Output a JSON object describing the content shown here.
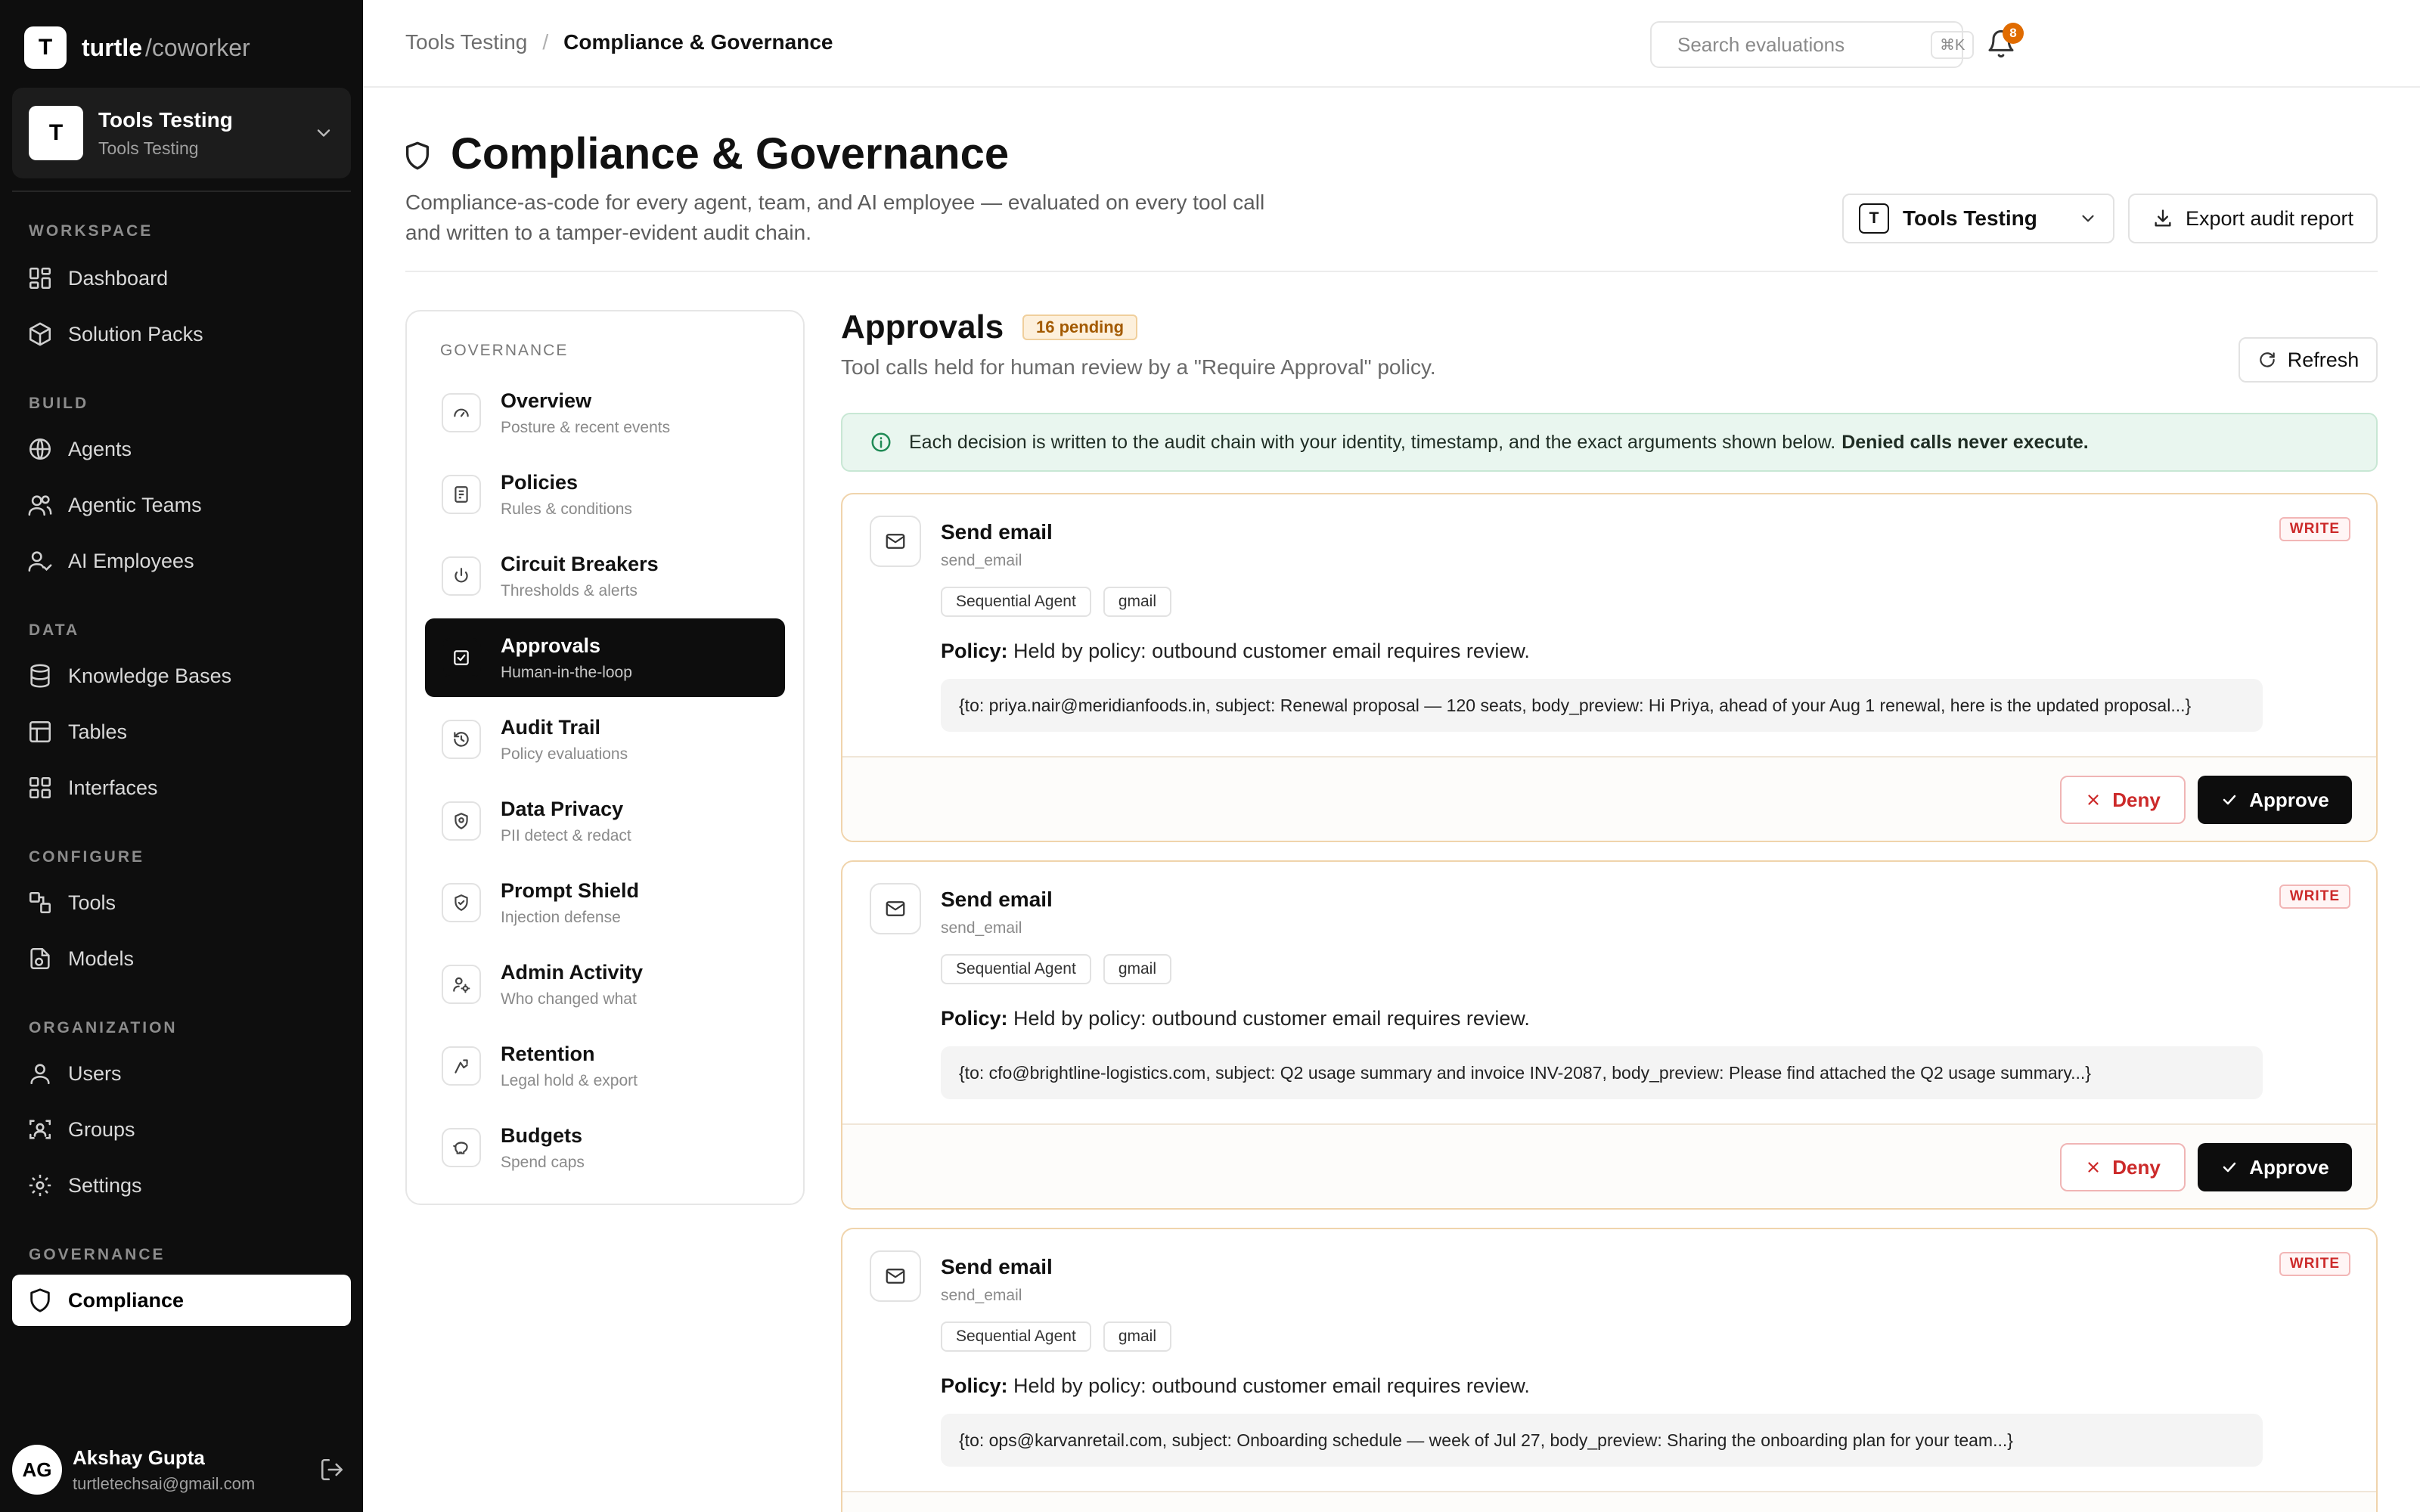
{
  "brand": {
    "logo_letter": "T",
    "name": "turtle",
    "suffix": "/coworker"
  },
  "workspace": {
    "avatar": "T",
    "title": "Tools Testing",
    "subtitle": "Tools Testing"
  },
  "sidebar": {
    "sections": [
      {
        "label": "WORKSPACE",
        "items": [
          {
            "label": "Dashboard",
            "icon": "dashboard-icon"
          },
          {
            "label": "Solution Packs",
            "icon": "package-icon"
          }
        ]
      },
      {
        "label": "BUILD",
        "items": [
          {
            "label": "Agents",
            "icon": "globe-icon"
          },
          {
            "label": "Agentic Teams",
            "icon": "users-icon"
          },
          {
            "label": "AI Employees",
            "icon": "user-check-icon"
          }
        ]
      },
      {
        "label": "DATA",
        "items": [
          {
            "label": "Knowledge Bases",
            "icon": "database-icon"
          },
          {
            "label": "Tables",
            "icon": "table-icon"
          },
          {
            "label": "Interfaces",
            "icon": "layout-icon"
          }
        ]
      },
      {
        "label": "CONFIGURE",
        "items": [
          {
            "label": "Tools",
            "icon": "tools-icon"
          },
          {
            "label": "Models",
            "icon": "model-icon"
          }
        ]
      },
      {
        "label": "ORGANIZATION",
        "items": [
          {
            "label": "Users",
            "icon": "user-icon"
          },
          {
            "label": "Groups",
            "icon": "group-icon"
          },
          {
            "label": "Settings",
            "icon": "gear-icon"
          }
        ]
      },
      {
        "label": "GOVERNANCE",
        "items": [
          {
            "label": "Compliance",
            "icon": "shield-icon",
            "active": true
          }
        ]
      }
    ]
  },
  "user": {
    "initials": "AG",
    "name": "Akshay Gupta",
    "email": "turtletechsai@gmail.com"
  },
  "topbar": {
    "breadcrumb_parent": "Tools Testing",
    "breadcrumb_sep": "/",
    "breadcrumb_current": "Compliance & Governance",
    "search_placeholder": "Search evaluations",
    "search_shortcut": "⌘K",
    "notifications": "8"
  },
  "page": {
    "title": "Compliance & Governance",
    "description": "Compliance-as-code for every agent, team, and AI employee — evaluated on every tool call and written to a tamper-evident audit chain.",
    "org_badge": "T",
    "org_name": "Tools Testing",
    "export_label": "Export audit report"
  },
  "governance_nav": {
    "header": "GOVERNANCE",
    "items": [
      {
        "title": "Overview",
        "desc": "Posture & recent events",
        "icon": "gauge-icon"
      },
      {
        "title": "Policies",
        "desc": "Rules & conditions",
        "icon": "document-icon"
      },
      {
        "title": "Circuit Breakers",
        "desc": "Thresholds & alerts",
        "icon": "power-icon"
      },
      {
        "title": "Approvals",
        "desc": "Human-in-the-loop",
        "icon": "check-square-icon",
        "active": true
      },
      {
        "title": "Audit Trail",
        "desc": "Policy evaluations",
        "icon": "history-icon"
      },
      {
        "title": "Data Privacy",
        "desc": "PII detect & redact",
        "icon": "privacy-shield-icon"
      },
      {
        "title": "Prompt Shield",
        "desc": "Injection defense",
        "icon": "shield-check-icon"
      },
      {
        "title": "Admin Activity",
        "desc": "Who changed what",
        "icon": "user-cog-icon"
      },
      {
        "title": "Retention",
        "desc": "Legal hold & export",
        "icon": "archive-icon"
      },
      {
        "title": "Budgets",
        "desc": "Spend caps",
        "icon": "piggy-bank-icon"
      }
    ]
  },
  "approvals": {
    "title": "Approvals",
    "pending_badge": "16 pending",
    "subtitle": "Tool calls held for human review by a \"Require Approval\" policy.",
    "refresh_label": "Refresh",
    "banner_text": "Each decision is written to the audit chain with your identity, timestamp, and the exact arguments shown below.",
    "banner_strong": "Denied calls never execute.",
    "policy_label": "Policy:",
    "deny_label": "Deny",
    "approve_label": "Approve",
    "cards": [
      {
        "title": "Send email",
        "code": "send_email",
        "badge": "WRITE",
        "tags": [
          "Sequential Agent",
          "gmail"
        ],
        "policy": "Held by policy: outbound customer email requires review.",
        "args": "{to: priya.nair@meridianfoods.in, subject: Renewal proposal — 120 seats, body_preview: Hi Priya, ahead of your Aug 1 renewal, here is the updated proposal...}"
      },
      {
        "title": "Send email",
        "code": "send_email",
        "badge": "WRITE",
        "tags": [
          "Sequential Agent",
          "gmail"
        ],
        "policy": "Held by policy: outbound customer email requires review.",
        "args": "{to: cfo@brightline-logistics.com, subject: Q2 usage summary and invoice INV-2087, body_preview: Please find attached the Q2 usage summary...}"
      },
      {
        "title": "Send email",
        "code": "send_email",
        "badge": "WRITE",
        "tags": [
          "Sequential Agent",
          "gmail"
        ],
        "policy": "Held by policy: outbound customer email requires review.",
        "args": "{to: ops@karvanretail.com, subject: Onboarding schedule — week of Jul 27, body_preview: Sharing the onboarding plan for your team...}"
      }
    ]
  }
}
